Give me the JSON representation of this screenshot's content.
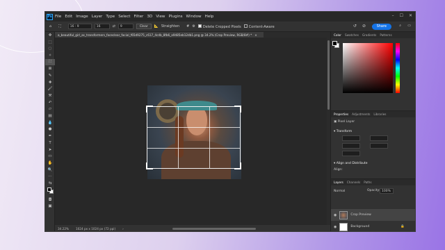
{
  "app": {
    "logo": "Ps",
    "menu": [
      "File",
      "Edit",
      "Image",
      "Layer",
      "Type",
      "Select",
      "Filter",
      "3D",
      "View",
      "Plugins",
      "Window",
      "Help"
    ]
  },
  "options": {
    "ratio_value": "16 : 9",
    "ratio_w": "16",
    "ratio_h": "9",
    "clear": "Clear",
    "straighten": "Straighten",
    "delete_cropped": "Delete Cropped Pixels",
    "content_aware": "Content-Aware",
    "share": "Share"
  },
  "document": {
    "tab": "a_beautiful_girl_as_transformers_faceclear_facial_f65d9275_c617_4cdb_8fb6_a9485eb12db1.png @ 34.2% (Crop Preview, RGB/8#) *",
    "zoom": "34.22%",
    "size": "1024 px x 1024 px (72 ppi)"
  },
  "color_panel": {
    "tabs": [
      "Color",
      "Swatches",
      "Gradients",
      "Patterns"
    ]
  },
  "properties_panel": {
    "tabs": [
      "Properties",
      "Adjustments",
      "Libraries"
    ],
    "type": "Pixel Layer",
    "transform": "Transform",
    "align": "Align and Distribute",
    "align_sub": "Align:"
  },
  "layers_panel": {
    "tabs": [
      "Layers",
      "Channels",
      "Paths"
    ],
    "blend_mode": "Normal",
    "opacity_label": "Opacity:",
    "opacity": "100%",
    "layers": [
      {
        "name": "Crop Preview"
      },
      {
        "name": "Background"
      }
    ]
  },
  "icons": [
    "home-icon",
    "crop-icon",
    "move-icon",
    "marquee-icon",
    "lasso-icon",
    "brush-icon",
    "eraser-icon",
    "text-icon",
    "hand-icon",
    "zoom-icon",
    "eye-icon",
    "undo-icon",
    "gear-icon"
  ]
}
